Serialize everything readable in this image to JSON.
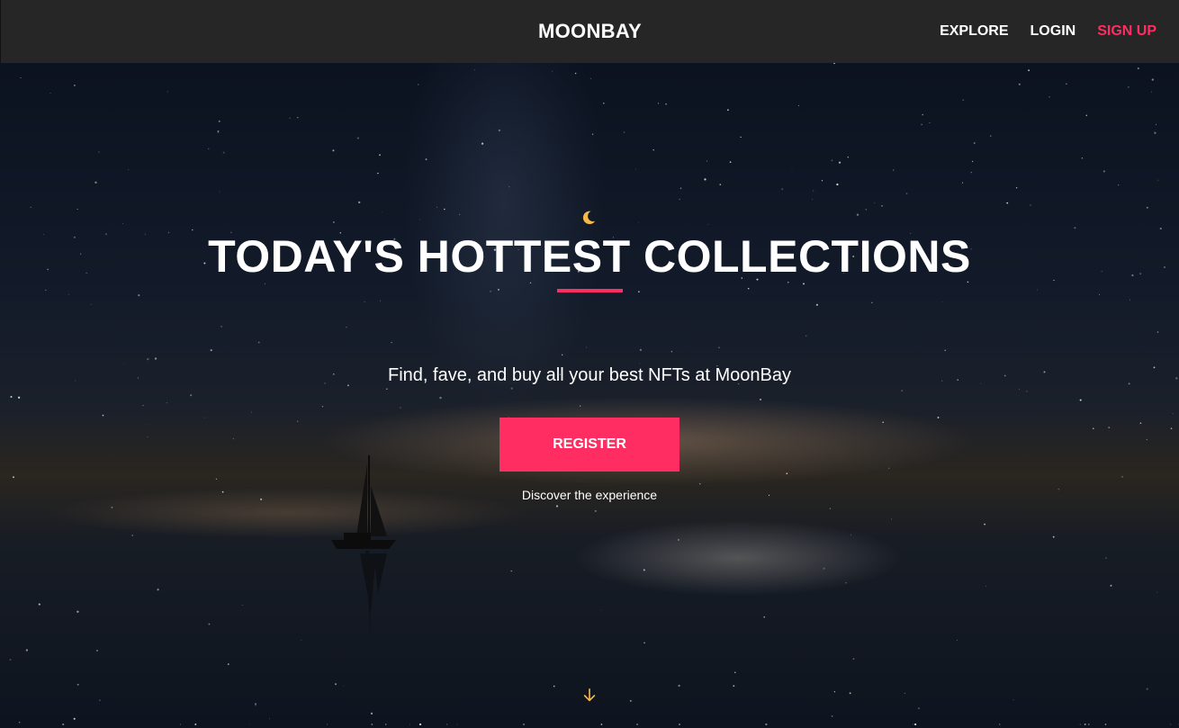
{
  "header": {
    "brand": "MOONBAY",
    "nav": {
      "explore": "EXPLORE",
      "login": "LOGIN",
      "signup": "SIGN UP"
    }
  },
  "hero": {
    "headline": "TODAY'S HOTTEST COLLECTIONS",
    "tagline": "Find, fave, and buy all your best NFTs at MoonBay",
    "register_label": "REGISTER",
    "discover_text": "Discover the experience",
    "icons": {
      "top": "moon-icon",
      "bottom": "arrow-down-icon"
    }
  },
  "colors": {
    "accent": "#ff2d62",
    "navbar": "#262626",
    "icon_gold": "#f5b84a"
  }
}
